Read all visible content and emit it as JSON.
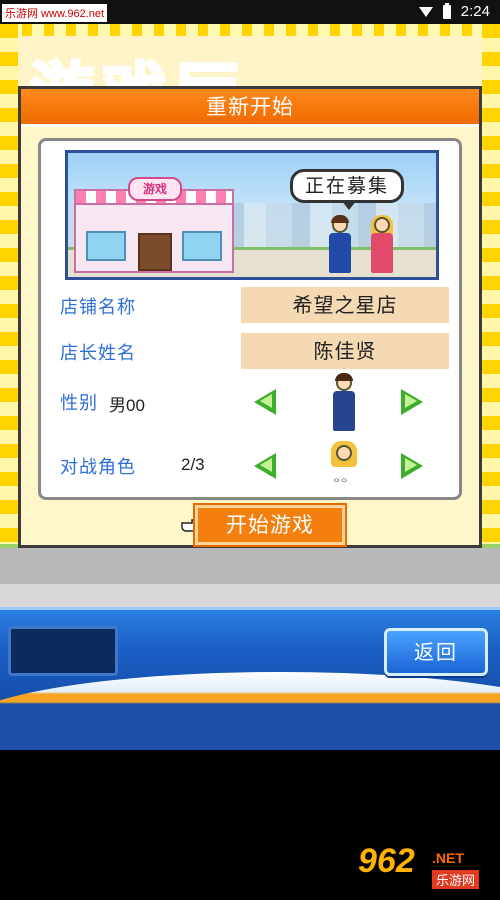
{
  "status_bar": {
    "watermark": "乐游网 www.962.net",
    "time": "2:24",
    "icons": [
      "wifi-icon",
      "battery-icon"
    ]
  },
  "background": {
    "marquee_title": "游戏厅"
  },
  "dialog": {
    "title": "重新开始",
    "scene": {
      "shop_sign": "游戏",
      "bubble": "正在募集"
    },
    "fields": {
      "shop_name": {
        "label": "店铺名称",
        "value": "希望之星店"
      },
      "manager_name": {
        "label": "店长姓名",
        "value": "陈佳贤"
      },
      "gender": {
        "label": "性别",
        "value": "男00"
      },
      "opponent": {
        "label": "对战角色",
        "value": "2/3",
        "tag": "ᄋᄋ"
      }
    },
    "start_button": "开始游戏"
  },
  "bottom_ui": {
    "back_button": "返回"
  },
  "watermark_bottom": {
    "logo": "962",
    "net": ".NET",
    "site": "乐游网"
  },
  "colors": {
    "header_orange": "#f06a00",
    "label_blue": "#2f6fd9",
    "field_bg": "#f4d9b3",
    "arrow_green": "#3cae2a",
    "panel_bg": "#fff7c9"
  }
}
